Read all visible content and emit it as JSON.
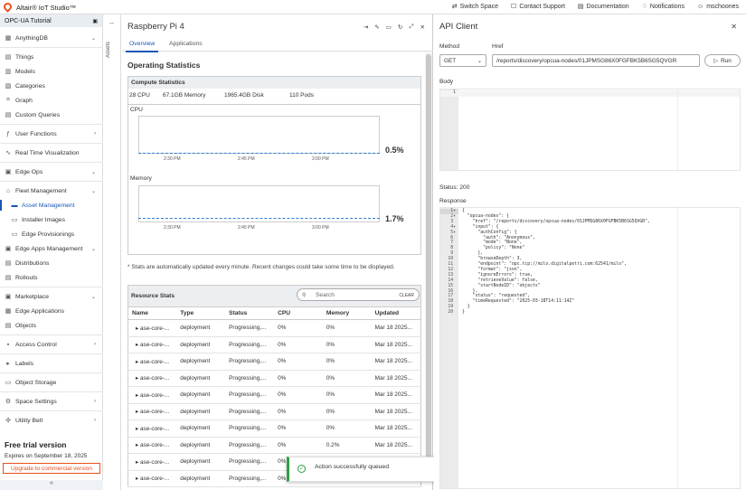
{
  "topbar": {
    "app_title": "Altair® IoT Studio™",
    "links": [
      {
        "label": "Switch Space",
        "icon": "switch-icon"
      },
      {
        "label": "Contact Support",
        "icon": "chat-icon"
      },
      {
        "label": "Documentation",
        "icon": "book-icon"
      },
      {
        "label": "Notifications",
        "icon": "bell-icon"
      },
      {
        "label": "mschoones",
        "icon": "user-icon"
      }
    ],
    "accent_color": "#e8501e"
  },
  "sidebar": {
    "space_name": "OPC-UA Tutorial",
    "items": [
      {
        "label": "AnythingDB",
        "icon": "database-icon",
        "chevron": "⌄"
      },
      {
        "label": "Things",
        "icon": "things-icon"
      },
      {
        "label": "Models",
        "icon": "models-icon"
      },
      {
        "label": "Categories",
        "icon": "categories-icon"
      },
      {
        "label": "Graph",
        "icon": "graph-icon"
      },
      {
        "label": "Custom Queries",
        "icon": "query-icon"
      },
      {
        "label": "User Functions",
        "icon": "function-icon",
        "chevron": "›"
      },
      {
        "label": "Real Time Visualization",
        "icon": "visualization-icon"
      },
      {
        "label": "Edge Ops",
        "icon": "edge-ops-icon",
        "chevron": "⌄"
      },
      {
        "label": "Fleet Management",
        "icon": "fleet-icon",
        "chevron": "⌄"
      },
      {
        "label": "Asset Management",
        "icon": "asset-icon"
      },
      {
        "label": "Installer Images",
        "icon": "image-icon"
      },
      {
        "label": "Edge Provisionings",
        "icon": "provision-icon"
      },
      {
        "label": "Edge Apps Management",
        "icon": "apps-icon",
        "chevron": "⌄"
      },
      {
        "label": "Distributions",
        "icon": "distribution-icon"
      },
      {
        "label": "Rollouts",
        "icon": "rollout-icon"
      },
      {
        "label": "Marketplace",
        "icon": "market-icon",
        "chevron": "⌄"
      },
      {
        "label": "Edge Applications",
        "icon": "edge-app-icon"
      },
      {
        "label": "Objects",
        "icon": "objects-icon"
      },
      {
        "label": "Access Control",
        "icon": "lock-icon",
        "chevron": "›"
      },
      {
        "label": "Labels",
        "icon": "label-icon"
      },
      {
        "label": "Object Storage",
        "icon": "storage-icon"
      },
      {
        "label": "Space Settings",
        "icon": "settings-icon",
        "chevron": "›"
      },
      {
        "label": "Utility Belt",
        "icon": "utility-icon",
        "chevron": "›"
      }
    ],
    "trial_title": "Free trial version",
    "trial_expires": "Expires on September 18, 2025",
    "upgrade_label": "Upgrade to commercial version",
    "collapse_label": "«"
  },
  "rail": {
    "label": "Assets"
  },
  "device": {
    "title": "Raspberry Pi 4",
    "tabs": [
      "Overview",
      "Applications"
    ],
    "section_title": "Operating Statistics",
    "compute": {
      "header": "Compute Statistics",
      "cpu": "28 CPU",
      "memory": "67.1GB Memory",
      "disk": "1965.4GB Disk",
      "pods": "110 Pods"
    },
    "cpu_chart": {
      "label": "CPU",
      "value": "0.5%",
      "ticks": [
        "2:30 PM",
        "2:45 PM",
        "3:00 PM"
      ]
    },
    "memory_chart": {
      "label": "Memory",
      "value": "1.7%",
      "ticks": [
        "2:30 PM",
        "2:45 PM",
        "3:00 PM"
      ]
    },
    "note": "* Stats are automatically updated every minute. Recent changes could take some time to be displayed.",
    "resource": {
      "title": "Resource Stats",
      "search_placeholder": "Search",
      "clear_label": "CLEAR",
      "columns": [
        "Name",
        "Type",
        "Status",
        "CPU",
        "Memory",
        "Updated"
      ],
      "rows": [
        [
          "ase-core-...",
          "deployment",
          "Progressing,...",
          "0%",
          "0%",
          "Mar 18 2025..."
        ],
        [
          "ase-core-...",
          "deployment",
          "Progressing,...",
          "0%",
          "0%",
          "Mar 18 2025..."
        ],
        [
          "ase-core-...",
          "deployment",
          "Progressing,...",
          "0%",
          "0%",
          "Mar 18 2025..."
        ],
        [
          "ase-core-...",
          "deployment",
          "Progressing,...",
          "0%",
          "0%",
          "Mar 18 2025..."
        ],
        [
          "ase-core-...",
          "deployment",
          "Progressing,...",
          "0%",
          "0%",
          "Mar 18 2025..."
        ],
        [
          "ase-core-...",
          "deployment",
          "Progressing,...",
          "0%",
          "0%",
          "Mar 18 2025..."
        ],
        [
          "ase-core-...",
          "deployment",
          "Progressing,...",
          "0%",
          "0%",
          "Mar 18 2025..."
        ],
        [
          "ase-core-...",
          "deployment",
          "Progressing,...",
          "0%",
          "0.2%",
          "Mar 18 2025..."
        ],
        [
          "ase-core-...",
          "deployment",
          "Progressing,...",
          "0%",
          "0%",
          "Mar 18 2025..."
        ],
        [
          "ase-core-...",
          "deployment",
          "Progressing,...",
          "0%",
          "0%",
          "Mar 18 2025..."
        ]
      ]
    }
  },
  "toast": {
    "message": "Action successfully queued",
    "color": "#2e9e45"
  },
  "api": {
    "title": "API Client",
    "method_label": "Method",
    "href_label": "Href",
    "method": "GET",
    "href": "/reports/discovery/opcua-nodes/01JPMSG86X0FGFBK5B6SG5QVGR",
    "run_label": "Run",
    "body_label": "Body",
    "body_line": "1",
    "status": "Status: 200",
    "response_label": "Response",
    "response_lines": [
      "{",
      "  \"opcua-nodes\": {",
      "    \"href\": \"/reports/discovery/opcua-nodes/01JPMSG86X0FGFBK5B6SG5QVGR\",",
      "    \"input\": {",
      "      \"authConfig\": {",
      "        \"auth\": \"Anonymous\",",
      "        \"mode\": \"None\",",
      "        \"policy\": \"None\"",
      "      },",
      "      \"browseDepth\": 3,",
      "      \"endpoint\": \"opc.tcp://milo.digitalpetri.com:62541/milo\",",
      "      \"format\": \"json\",",
      "      \"ignoreErrors\": true,",
      "      \"retrieveValue\": false,",
      "      \"startNodeID\": \"objects\"",
      "    },",
      "    \"status\": \"requested\",",
      "    \"timeRequested\": \"2025-03-18T14:11:14Z\"",
      "  }",
      "}"
    ]
  }
}
